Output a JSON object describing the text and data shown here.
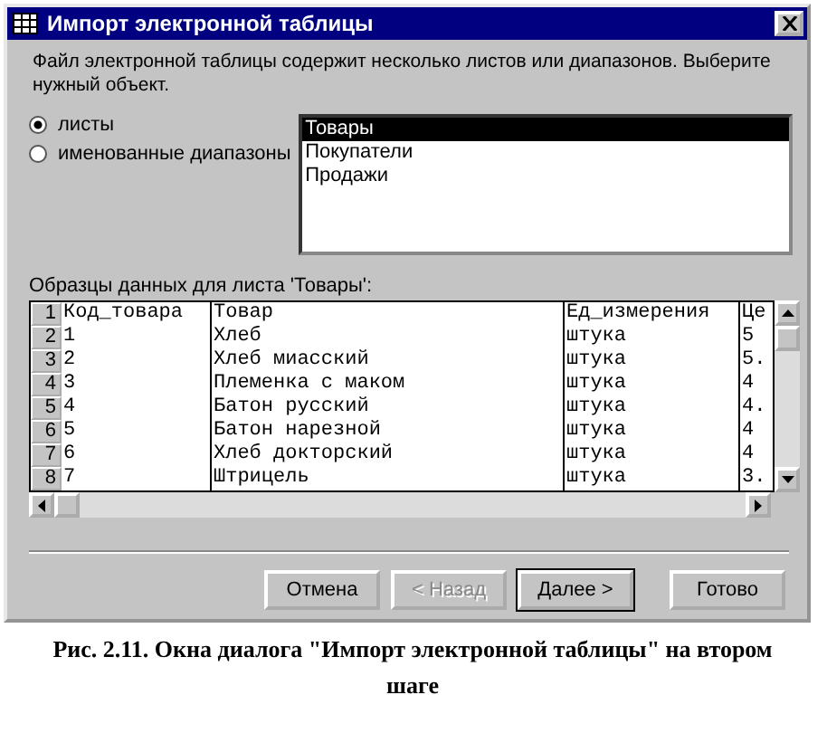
{
  "window": {
    "title": "Импорт электронной таблицы"
  },
  "description": "Файл электронной таблицы содержит несколько листов или диапазонов.  Выберите нужный объект.",
  "options": [
    {
      "label": "листы",
      "selected": true
    },
    {
      "label": "именованные диапазоны",
      "selected": false
    }
  ],
  "list": [
    {
      "label": "Товары",
      "selected": true
    },
    {
      "label": "Покупатели",
      "selected": false
    },
    {
      "label": "Продажи",
      "selected": false
    }
  ],
  "sample": {
    "label": "Образцы данных для листа 'Товары':",
    "rows": [
      {
        "number": "1",
        "cells": [
          "Код_товара",
          "Товар",
          "Ед_измерения",
          "Це"
        ]
      },
      {
        "number": "2",
        "cells": [
          "1",
          "Хлеб",
          "штука",
          "5"
        ]
      },
      {
        "number": "3",
        "cells": [
          "2",
          "Хлеб миасский",
          "штука",
          "5."
        ]
      },
      {
        "number": "4",
        "cells": [
          "3",
          "Племенка с маком",
          "штука",
          "4"
        ]
      },
      {
        "number": "5",
        "cells": [
          "4",
          "Батон русский",
          "штука",
          "4."
        ]
      },
      {
        "number": "6",
        "cells": [
          "5",
          "Батон нарезной",
          "штука",
          "4"
        ]
      },
      {
        "number": "7",
        "cells": [
          "6",
          "Хлеб докторский",
          "штука",
          "4"
        ]
      },
      {
        "number": "8",
        "cells": [
          "7",
          "Штрицель",
          "штука",
          "3."
        ]
      }
    ]
  },
  "buttons": [
    {
      "label": "Отмена",
      "disabled": false,
      "default": false
    },
    {
      "label": "< Назад",
      "disabled": true,
      "default": false
    },
    {
      "label": "Далее >",
      "disabled": false,
      "default": true
    },
    {
      "label": "Готово",
      "disabled": false,
      "default": false
    }
  ],
  "caption": "Рис. 2.11. Окна диалога \"Импорт электронной таблицы\" на втором шаге"
}
